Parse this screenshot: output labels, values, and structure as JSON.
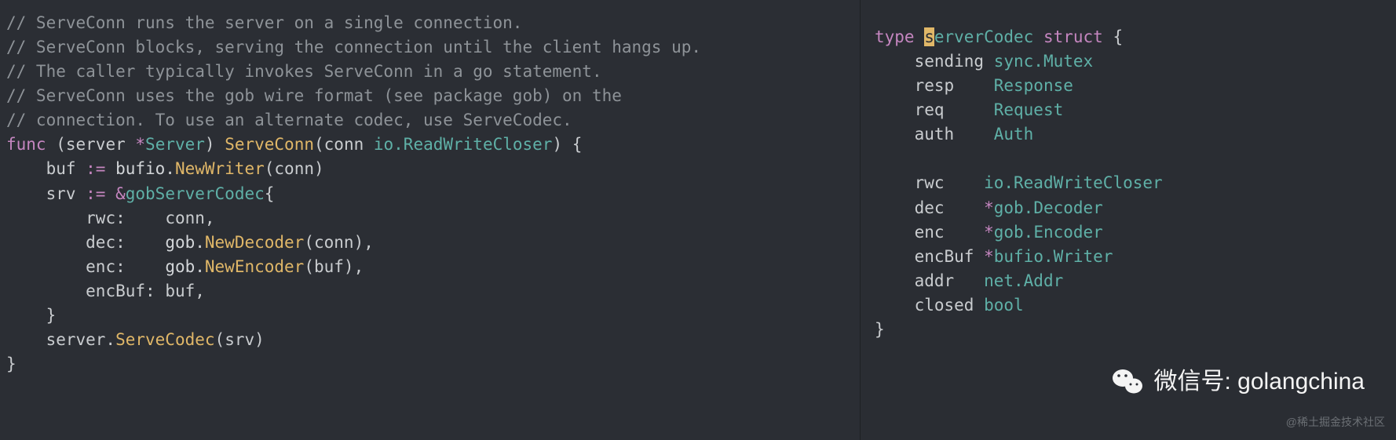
{
  "leftCode": {
    "comment1": "// ServeConn runs the server on a single connection.",
    "comment2": "// ServeConn blocks, serving the connection until the client hangs up.",
    "comment3": "// The caller typically invokes ServeConn in a go statement.",
    "comment4": "// ServeConn uses the gob wire format (see package gob) on the",
    "comment5": "// connection. To use an alternate codec, use ServeCodec.",
    "line6": {
      "func": "func",
      "lparen": " (",
      "receiver": "server ",
      "star": "*",
      "rtype": "Server",
      "rparen": ") ",
      "method": "ServeConn",
      "open": "(",
      "param": "conn ",
      "ptype": "io.ReadWriteCloser",
      "close": ") {"
    },
    "line7": {
      "indent": "    ",
      "var": "buf ",
      "op": ":= ",
      "pkg": "bufio.",
      "call": "NewWriter",
      "paren": "(",
      "arg": "conn",
      "cparen": ")"
    },
    "line8": {
      "indent": "    ",
      "var": "srv ",
      "op": ":= ",
      "amp": "&",
      "type": "gobServerCodec",
      "brace": "{"
    },
    "line9": {
      "indent": "        ",
      "field": "rwc:    ",
      "val": "conn,"
    },
    "line10": {
      "indent": "        ",
      "field": "dec:    ",
      "pkg": "gob.",
      "call": "NewDecoder",
      "paren": "(",
      "arg": "conn",
      "cparen": "),"
    },
    "line11": {
      "indent": "        ",
      "field": "enc:    ",
      "pkg": "gob.",
      "call": "NewEncoder",
      "paren": "(",
      "arg": "buf",
      "cparen": "),"
    },
    "line12": {
      "indent": "        ",
      "field": "encBuf: ",
      "val": "buf,"
    },
    "line13": "    }",
    "line14": {
      "indent": "    ",
      "obj": "server.",
      "call": "ServeCodec",
      "paren": "(",
      "arg": "srv",
      "cparen": ")"
    },
    "line15": "}"
  },
  "rightCode": {
    "line1": {
      "kw": "type ",
      "hl": "s",
      "name": "erverCodec ",
      "kw2": "struct ",
      "brace": "{"
    },
    "line2": {
      "indent": "    ",
      "field": "sending ",
      "type": "sync.Mutex"
    },
    "line3": {
      "indent": "    ",
      "field": "resp    ",
      "type": "Response"
    },
    "line4": {
      "indent": "    ",
      "field": "req     ",
      "type": "Request"
    },
    "line5": {
      "indent": "    ",
      "field": "auth    ",
      "type": "Auth"
    },
    "blank": "",
    "line6": {
      "indent": "    ",
      "field": "rwc    ",
      "type": "io.ReadWriteCloser"
    },
    "line7": {
      "indent": "    ",
      "field": "dec    ",
      "star": "*",
      "type": "gob.Decoder"
    },
    "line8": {
      "indent": "    ",
      "field": "enc    ",
      "star": "*",
      "type": "gob.Encoder"
    },
    "line9": {
      "indent": "    ",
      "field": "encBuf ",
      "star": "*",
      "type": "bufio.Writer"
    },
    "line10": {
      "indent": "    ",
      "field": "addr   ",
      "type": "net.Addr"
    },
    "line11": {
      "indent": "    ",
      "field": "closed ",
      "type": "bool"
    },
    "line12": "}"
  },
  "overlay": {
    "wechatLabel": "微信号: golangchina",
    "watermark": "@稀土掘金技术社区"
  }
}
